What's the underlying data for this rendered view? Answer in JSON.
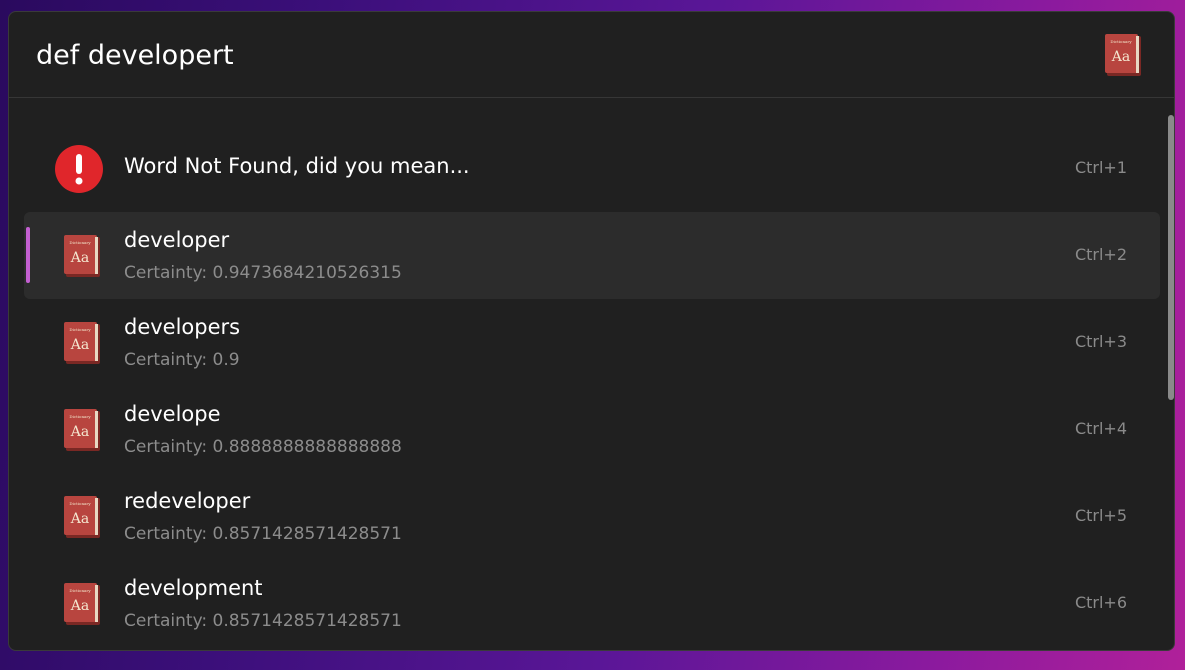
{
  "search": {
    "query": "def developert",
    "plugin_icon": "dictionary-book-icon"
  },
  "results": [
    {
      "title": "Word Not Found, did you mean...",
      "subtitle": "",
      "shortcut": "Ctrl+1",
      "icon": "error-icon",
      "selected": false
    },
    {
      "title": "developer",
      "subtitle": "Certainty: 0.9473684210526315",
      "shortcut": "Ctrl+2",
      "icon": "dictionary-book-icon",
      "selected": true
    },
    {
      "title": "developers",
      "subtitle": "Certainty: 0.9",
      "shortcut": "Ctrl+3",
      "icon": "dictionary-book-icon",
      "selected": false
    },
    {
      "title": "develope",
      "subtitle": "Certainty: 0.8888888888888888",
      "shortcut": "Ctrl+4",
      "icon": "dictionary-book-icon",
      "selected": false
    },
    {
      "title": "redeveloper",
      "subtitle": "Certainty: 0.8571428571428571",
      "shortcut": "Ctrl+5",
      "icon": "dictionary-book-icon",
      "selected": false
    },
    {
      "title": "development",
      "subtitle": "Certainty: 0.8571428571428571",
      "shortcut": "Ctrl+6",
      "icon": "dictionary-book-icon",
      "selected": false
    }
  ],
  "book_icon_text": "Aa",
  "book_icon_label": "Dictionary",
  "colors": {
    "accent": "#c35fd1",
    "error": "#e0262b",
    "book": "#b8453f",
    "window_bg": "#202020",
    "selected_bg": "#2c2c2c"
  }
}
